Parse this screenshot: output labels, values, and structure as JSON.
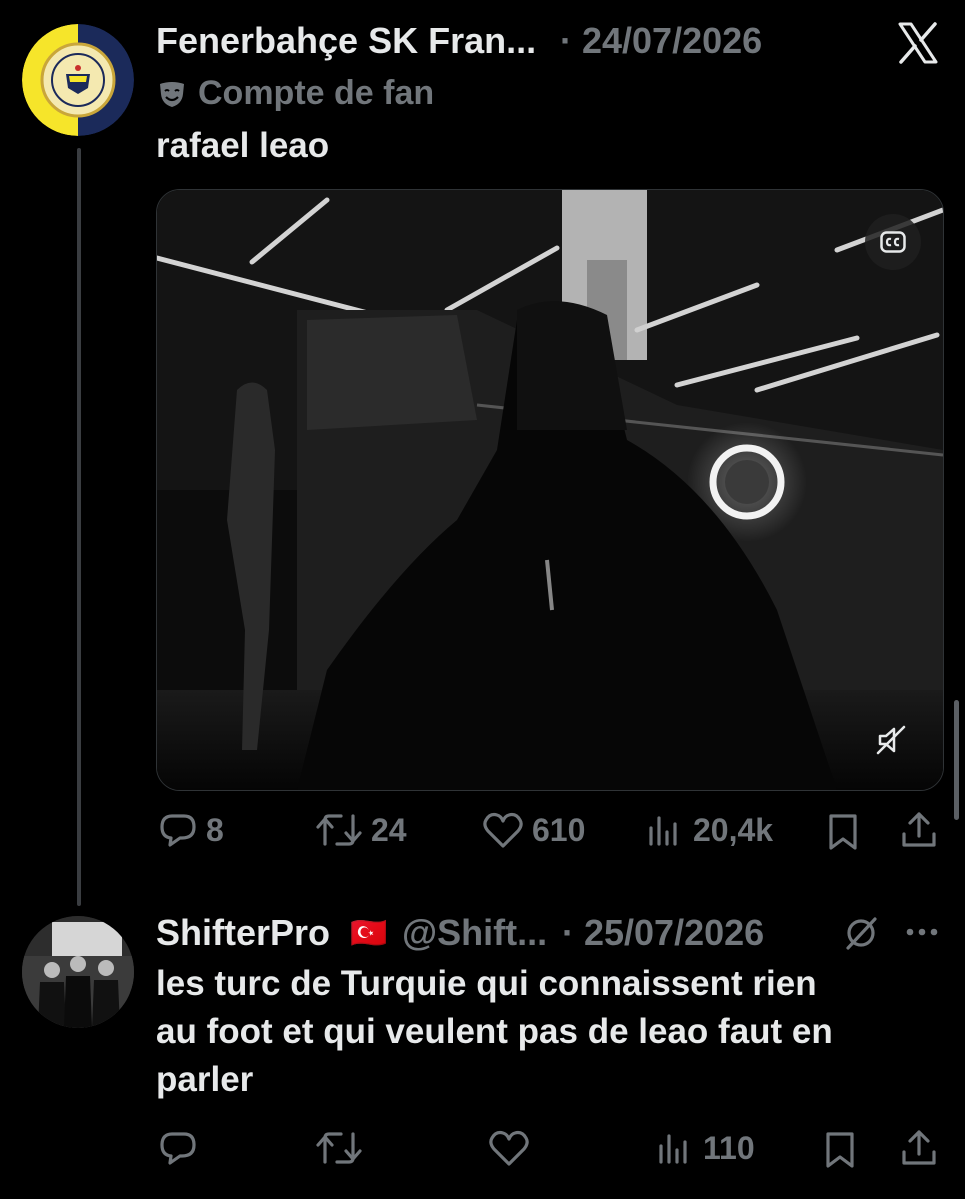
{
  "close_label": "𝕏",
  "tweet1": {
    "display_name": "Fenerbahçe SK Fran...",
    "date": "· 24/07/2026",
    "label_text": "Compte de fan",
    "label_icon": "theater-mask-icon",
    "text": "rafael leao",
    "media": {
      "type": "video",
      "has_captions_button": true,
      "muted": true
    },
    "actions": {
      "replies": "8",
      "reposts": "24",
      "likes": "610",
      "views": "20,4k"
    }
  },
  "tweet2": {
    "display_name": "ShifterPro",
    "flag": "🇹🇷",
    "handle": "@Shift...",
    "date": "· 25/07/2026",
    "text_lines": [
      "les turc de Turquie qui connaissent rien",
      "au foot et qui veulent  pas de leao faut en",
      "parler"
    ],
    "actions": {
      "replies": "",
      "reposts": "",
      "likes": "",
      "views": "110"
    }
  },
  "colors": {
    "background": "#000000",
    "text": "#e7e9ea",
    "muted": "#71767b",
    "fb_yellow": "#f6e52a",
    "fb_navy": "#1b2a5a"
  }
}
